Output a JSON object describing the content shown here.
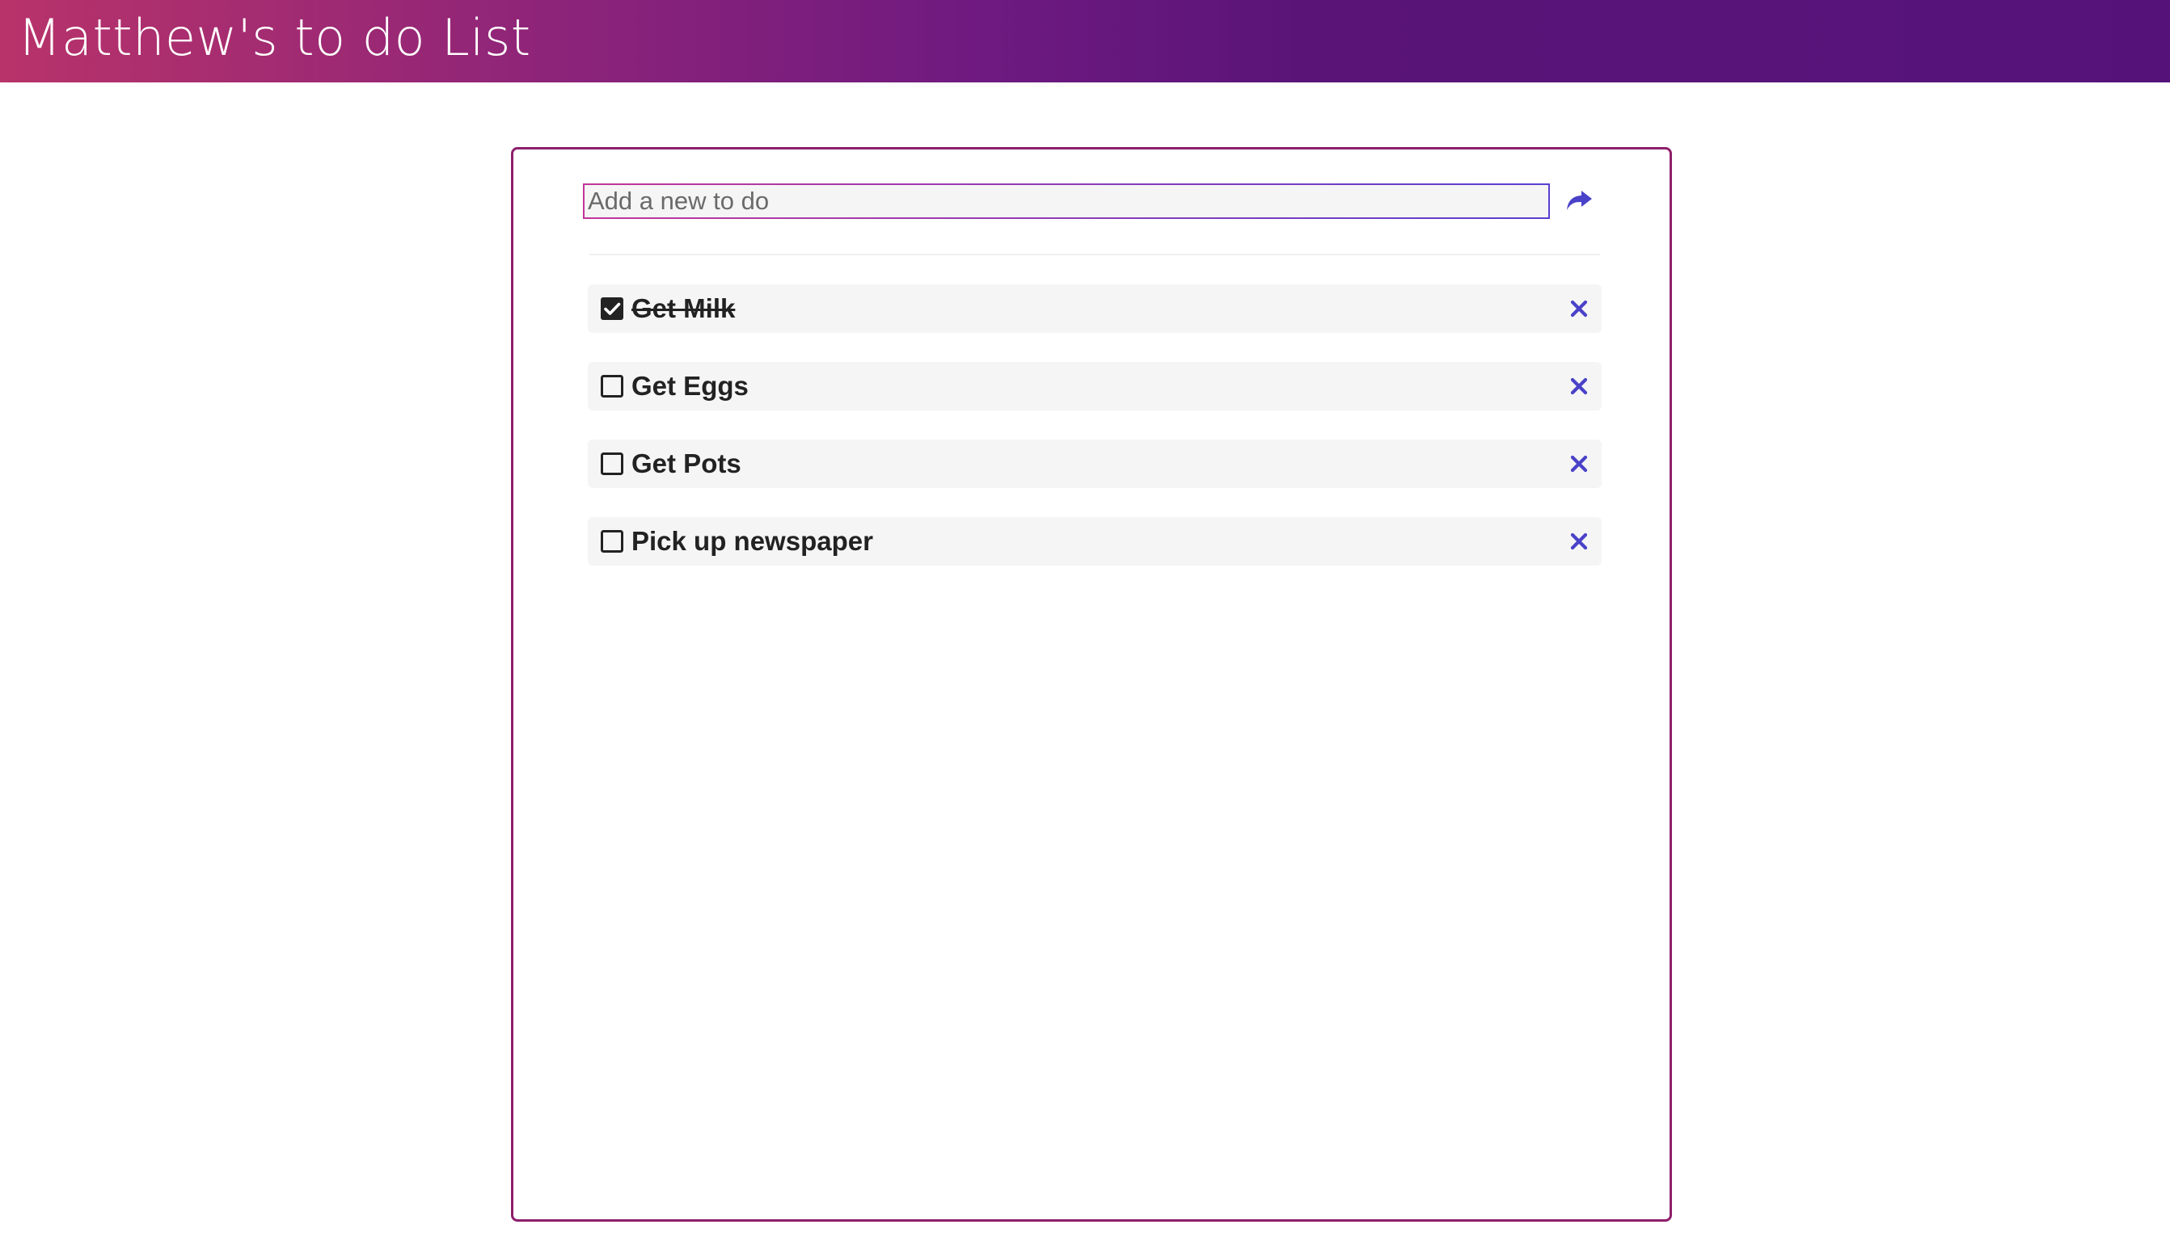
{
  "header": {
    "title": "Matthew's to do List",
    "gradient_start": "#b8336a",
    "gradient_end": "#55137a"
  },
  "new_todo": {
    "placeholder": "Add a new to do",
    "value": "",
    "submit_icon": "share-arrow-icon"
  },
  "todos": [
    {
      "label": "Get Milk",
      "done": true,
      "checkbox_icon": "checked-box-icon",
      "delete_icon": "close-icon"
    },
    {
      "label": "Get Eggs",
      "done": false,
      "checkbox_icon": "empty-box-icon",
      "delete_icon": "close-icon"
    },
    {
      "label": "Get Pots",
      "done": false,
      "checkbox_icon": "empty-box-icon",
      "delete_icon": "close-icon"
    },
    {
      "label": "Pick up newspaper",
      "done": false,
      "checkbox_icon": "empty-box-icon",
      "delete_icon": "close-icon"
    }
  ],
  "colors": {
    "accent": "#4a42c8",
    "card_border": "#8e1f6c",
    "item_background": "#f5f5f5"
  }
}
